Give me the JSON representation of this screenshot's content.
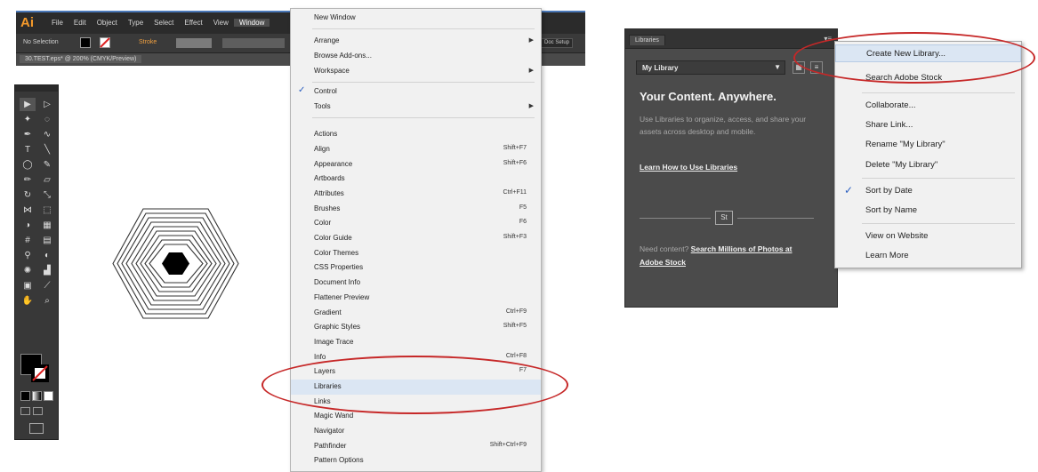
{
  "illustrator": {
    "logo": "Ai",
    "menus": [
      "File",
      "Edit",
      "Object",
      "Type",
      "Select",
      "Effect",
      "View",
      "Window"
    ],
    "active_menu": "Window",
    "control_bar": {
      "selection_label": "No Selection",
      "stroke_label": "Stroke",
      "doc_setup": "Doc Setup"
    },
    "doc_tab": "30.TEST.eps* @ 200% (CMYK/Preview)"
  },
  "window_menu": {
    "items": [
      {
        "label": "New Window"
      },
      {
        "label": "Arrange",
        "submenu": true
      },
      {
        "label": "Browse Add-ons..."
      },
      {
        "label": "Workspace",
        "submenu": true
      },
      {
        "label": "Control",
        "checked": true
      },
      {
        "label": "Tools",
        "submenu": true
      },
      {
        "label": "Actions"
      },
      {
        "label": "Align",
        "shortcut": "Shift+F7"
      },
      {
        "label": "Appearance",
        "shortcut": "Shift+F6"
      },
      {
        "label": "Artboards"
      },
      {
        "label": "Attributes",
        "shortcut": "Ctrl+F11"
      },
      {
        "label": "Brushes",
        "shortcut": "F5"
      },
      {
        "label": "Color",
        "shortcut": "F6"
      },
      {
        "label": "Color Guide",
        "shortcut": "Shift+F3"
      },
      {
        "label": "Color Themes"
      },
      {
        "label": "CSS Properties"
      },
      {
        "label": "Document Info"
      },
      {
        "label": "Flattener Preview"
      },
      {
        "label": "Gradient",
        "shortcut": "Ctrl+F9"
      },
      {
        "label": "Graphic Styles",
        "shortcut": "Shift+F5"
      },
      {
        "label": "Image Trace"
      },
      {
        "label": "Info",
        "shortcut": "Ctrl+F8"
      },
      {
        "label": "Layers",
        "shortcut": "F7"
      },
      {
        "label": "Libraries",
        "highlighted": true
      },
      {
        "label": "Links"
      },
      {
        "label": "Magic Wand"
      },
      {
        "label": "Navigator"
      },
      {
        "label": "Pathfinder",
        "shortcut": "Shift+Ctrl+F9"
      },
      {
        "label": "Pattern Options"
      }
    ]
  },
  "libraries_panel": {
    "tab": "Libraries",
    "library_name": "My Library",
    "headline": "Your Content. Anywhere.",
    "description": "Use Libraries to organize, access, and share your assets across desktop and mobile.",
    "learn_link": "Learn How to Use Libraries",
    "stock_badge": "St",
    "need_content": "Need content?",
    "stock_link": "Search Millions of Photos at Adobe Stock"
  },
  "libraries_menu": {
    "items": [
      {
        "label": "Create New Library...",
        "highlighted": true
      },
      {
        "label": "Search Adobe Stock"
      },
      {
        "label": "Collaborate..."
      },
      {
        "label": "Share Link..."
      },
      {
        "label": "Rename \"My Library\""
      },
      {
        "label": "Delete \"My Library\""
      },
      {
        "label": "Sort by Date",
        "checked": true
      },
      {
        "label": "Sort by Name"
      },
      {
        "label": "View on Website"
      },
      {
        "label": "Learn More"
      }
    ]
  },
  "colors": {
    "annotation_red": "#c62828",
    "menu_highlight": "#dbe6f3",
    "panel_dark": "#4b4b4b",
    "ai_orange": "#f59a2b"
  }
}
